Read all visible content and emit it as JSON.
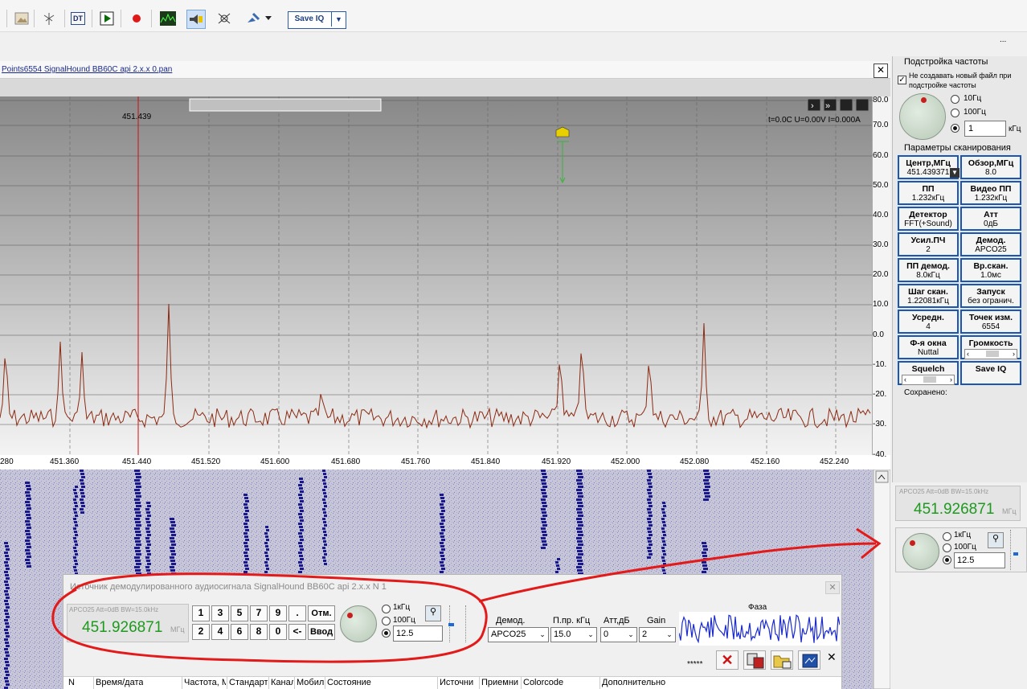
{
  "toolbar": {
    "buttons": [
      "image-icon",
      "antenna-icon",
      "dt-icon",
      "play-icon",
      "record-icon",
      "spectrum-icon",
      "sound-scan-icon",
      "direction-finder-icon",
      "satellite-icon"
    ],
    "dt_label": "DT",
    "save_iq": "Save IQ",
    "ellipsis": "..."
  },
  "main": {
    "title": "Points6554 SignalHound BB60C api 2.x.x 0.pan",
    "marker_freq": "451.439",
    "status": "t=0.0C U=0.00V I=0.000A",
    "y_ticks": [
      "80.0",
      "70.0",
      "60.0",
      "50.0",
      "40.0",
      "30.0",
      "20.0",
      "10.0",
      "0.0",
      "-10.",
      "-20.",
      "-30.",
      "-40."
    ],
    "x_ticks": [
      "280",
      "451.360",
      "451.440",
      "451.520",
      "451.600",
      "451.680",
      "451.760",
      "451.840",
      "451.920",
      "452.000",
      "452.080",
      "452.160",
      "452.240"
    ]
  },
  "tuning": {
    "title": "Подстройка частоты",
    "checkbox_label": "Не создавать новый файл при подстройке частоты",
    "r1": "10Гц",
    "r2": "100Гц",
    "value": "1",
    "unit": "кГц"
  },
  "scan": {
    "title": "Параметры сканирования",
    "buttons": [
      {
        "name": "Центр,МГц",
        "value": "451.439371"
      },
      {
        "name": "Обзор,МГц",
        "value": "8.0"
      },
      {
        "name": "ПП",
        "value": "1.232кГц"
      },
      {
        "name": "Видео ПП",
        "value": "1.232кГц"
      },
      {
        "name": "Детектор",
        "value": "FFT(+Sound)"
      },
      {
        "name": "Атт",
        "value": "0дБ"
      },
      {
        "name": "Усил.ПЧ",
        "value": "2"
      },
      {
        "name": "Демод.",
        "value": "APCO25"
      },
      {
        "name": "ПП демод.",
        "value": "8.0кГц"
      },
      {
        "name": "Вр.скан.",
        "value": "1.0мс"
      },
      {
        "name": "Шаг скан.",
        "value": "1.22081кГц"
      },
      {
        "name": "Запуск",
        "value": "без огранич."
      },
      {
        "name": "Усредн.",
        "value": "4"
      },
      {
        "name": "Точек изм.",
        "value": "6554"
      },
      {
        "name": "Ф-я окна",
        "value": "Nuttal"
      },
      {
        "name": "Громкость",
        "value": ""
      },
      {
        "name": "Squelch",
        "value": ""
      },
      {
        "name": "Save IQ",
        "value": ""
      }
    ],
    "saved": "Сохранено:"
  },
  "demod_display": {
    "info": "APCO25 Att=0dB BW=15.0kHz",
    "freq": "451.926871",
    "unit": "МГц"
  },
  "right_tuner": {
    "r1": "1кГц",
    "r2": "100Гц",
    "value": "12.5"
  },
  "dialog": {
    "title": "Источник демодулированного аудиосигнала SignalHound BB60C api 2.x.x N 1",
    "info": "APCO25 Att=0dB BW=15.0kHz",
    "freq": "451.926871",
    "unit": "МГц",
    "keys_row1": [
      "1",
      "3",
      "5",
      "7",
      "9",
      "."
    ],
    "keys_row2": [
      "2",
      "4",
      "6",
      "8",
      "0",
      "<-"
    ],
    "cancel": "Отм.",
    "enter": "Ввод",
    "r1": "1кГц",
    "r2": "100Гц",
    "value": "12.5",
    "demod_label": "Демод.",
    "demod_value": "APCO25",
    "bw_label": "П.пр. кГц",
    "bw_value": "15.0",
    "att_label": "Атт,дБ",
    "att_value": "0",
    "gain_label": "Gain",
    "gain_value": "2",
    "phase_label": "Фаза",
    "stars": "*****",
    "columns": [
      "N",
      "Время/дата",
      "Частота, М",
      "Стандарт",
      "Канал",
      "Мобил",
      "Состояние",
      "Источни",
      "Приемни",
      "Colorcode",
      "Дополнительно"
    ]
  },
  "colors": {
    "accent": "#1c56b5",
    "freq_green": "#1e9a1e",
    "trace": "#8b2a12",
    "annotation": "#e31a1a",
    "waterfall_signal": "#1a1a8c"
  }
}
